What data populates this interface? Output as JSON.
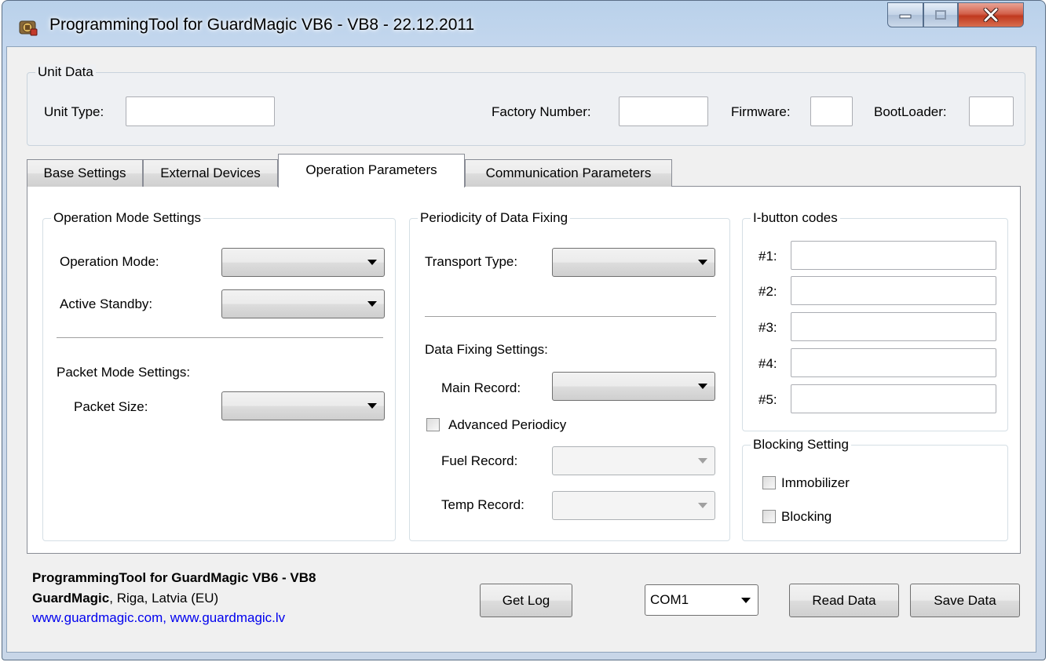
{
  "window": {
    "title": "ProgrammingTool for GuardMagic VB6 - VB8 - 22.12.2011",
    "icon": "app-icon"
  },
  "unit_data": {
    "legend": "Unit Data",
    "unit_type_label": "Unit Type:",
    "unit_type_value": "",
    "factory_number_label": "Factory Number:",
    "factory_number_value": "",
    "firmware_label": "Firmware:",
    "firmware_value": "",
    "bootloader_label": "BootLoader:",
    "bootloader_value": ""
  },
  "tabs": [
    {
      "label": "Base Settings",
      "active": false
    },
    {
      "label": "External Devices",
      "active": false
    },
    {
      "label": "Operation Parameters",
      "active": true
    },
    {
      "label": "Communication Parameters",
      "active": false
    }
  ],
  "operation_mode": {
    "legend": "Operation Mode Settings",
    "operation_mode_label": "Operation Mode:",
    "operation_mode_value": "",
    "active_standby_label": "Active Standby:",
    "active_standby_value": "",
    "packet_mode_heading": "Packet Mode Settings:",
    "packet_size_label": "Packet Size:",
    "packet_size_value": ""
  },
  "periodicity": {
    "legend": "Periodicity of Data Fixing",
    "transport_type_label": "Transport Type:",
    "transport_type_value": "",
    "data_fixing_heading": "Data Fixing Settings:",
    "main_record_label": "Main Record:",
    "main_record_value": "",
    "advanced_periodicy_label": "Advanced Periodicy",
    "advanced_periodicy_checked": false,
    "fuel_record_label": "Fuel Record:",
    "fuel_record_value": "",
    "temp_record_label": "Temp Record:",
    "temp_record_value": ""
  },
  "ibutton": {
    "legend": "I-button codes",
    "codes": [
      {
        "label": "#1:",
        "value": ""
      },
      {
        "label": "#2:",
        "value": ""
      },
      {
        "label": "#3:",
        "value": ""
      },
      {
        "label": "#4:",
        "value": ""
      },
      {
        "label": "#5:",
        "value": ""
      }
    ]
  },
  "blocking": {
    "legend": "Blocking Setting",
    "immobilizer_label": "Immobilizer",
    "immobilizer_checked": false,
    "blocking_label": "Blocking",
    "blocking_checked": false
  },
  "footer": {
    "title": "ProgrammingTool for GuardMagic VB6 - VB8",
    "company_name": "GuardMagic",
    "company_location": ", Riga, Latvia (EU)",
    "links": "www.guardmagic.com, www.guardmagic.lv",
    "get_log_label": "Get Log",
    "com_port_value": "COM1",
    "read_data_label": "Read Data",
    "save_data_label": "Save Data"
  },
  "colors": {
    "link": "#0000ee",
    "close_button": "#c7432a",
    "title_bar": "#b9d1ea"
  }
}
